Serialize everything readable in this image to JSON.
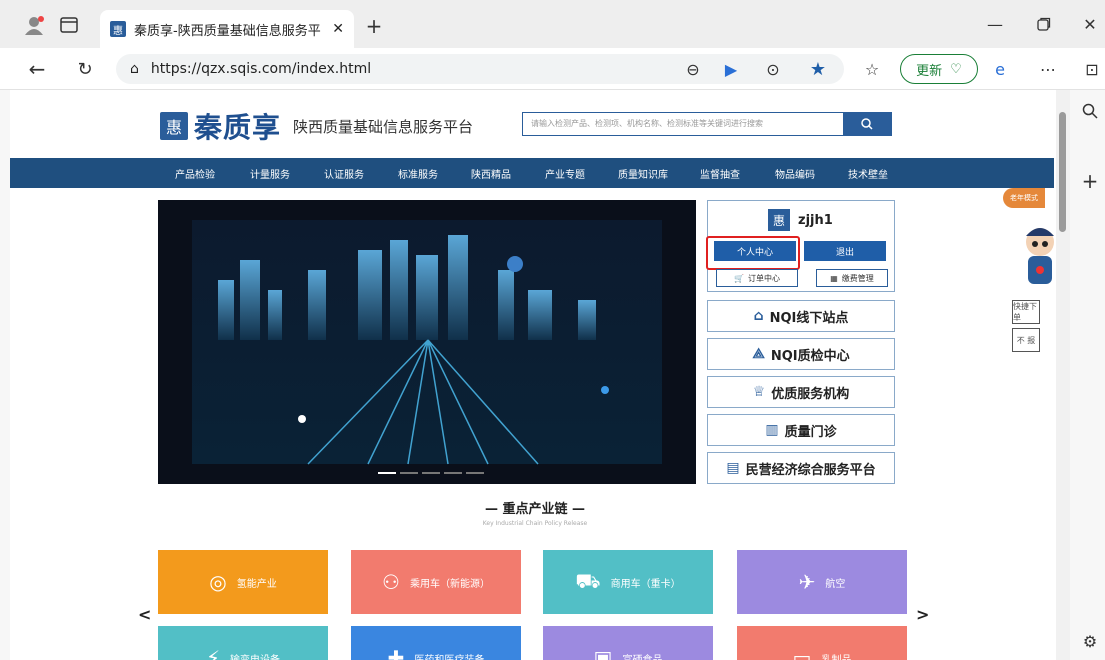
{
  "browser": {
    "tab_title": "秦质享-陕西质量基础信息服务平",
    "tab_favicon": "惠",
    "url": "https://qzx.sqis.com/index.html",
    "update_label": "更新"
  },
  "site": {
    "logo_badge": "惠",
    "logo_name": "秦质享",
    "logo_subtitle": "陕西质量基础信息服务平台",
    "search_placeholder": "请输入检测产品、检测项、机构名称、检测标准等关键词进行搜索",
    "nav": [
      "产品检验",
      "计量服务",
      "认证服务",
      "标准服务",
      "陕西精品",
      "产业专题",
      "质量知识库",
      "监督抽查",
      "物品编码",
      "技术壁垒"
    ]
  },
  "user_panel": {
    "badge": "惠",
    "username": "zjjh1",
    "personal_center": "个人中心",
    "logout": "退出",
    "orders": "订单中心",
    "invoice": "缴费管理"
  },
  "services": [
    "NQI线下站点",
    "NQI质检中心",
    "优质服务机构",
    "质量门诊",
    "民营经济综合服务平台"
  ],
  "section": {
    "title": "重点产业链",
    "subtitle": "Key Industrial Chain Policy Release"
  },
  "chain_cards": [
    {
      "label": "氢能产业",
      "color": "#f39a1c"
    },
    {
      "label": "乘用车（新能源）",
      "color": "#f27b6e"
    },
    {
      "label": "商用车（重卡）",
      "color": "#52bfc6"
    },
    {
      "label": "航空",
      "color": "#9c8ae0"
    },
    {
      "label": "输变电设备",
      "color": "#52bfc6"
    },
    {
      "label": "医药和医疗装备",
      "color": "#3a86e0"
    },
    {
      "label": "富硒食品",
      "color": "#9c8ae0"
    },
    {
      "label": "乳制品",
      "color": "#f27b6e"
    }
  ],
  "float": {
    "elder_mode": "老年模式",
    "quick_order": "快捷下单",
    "report": "不 报"
  }
}
